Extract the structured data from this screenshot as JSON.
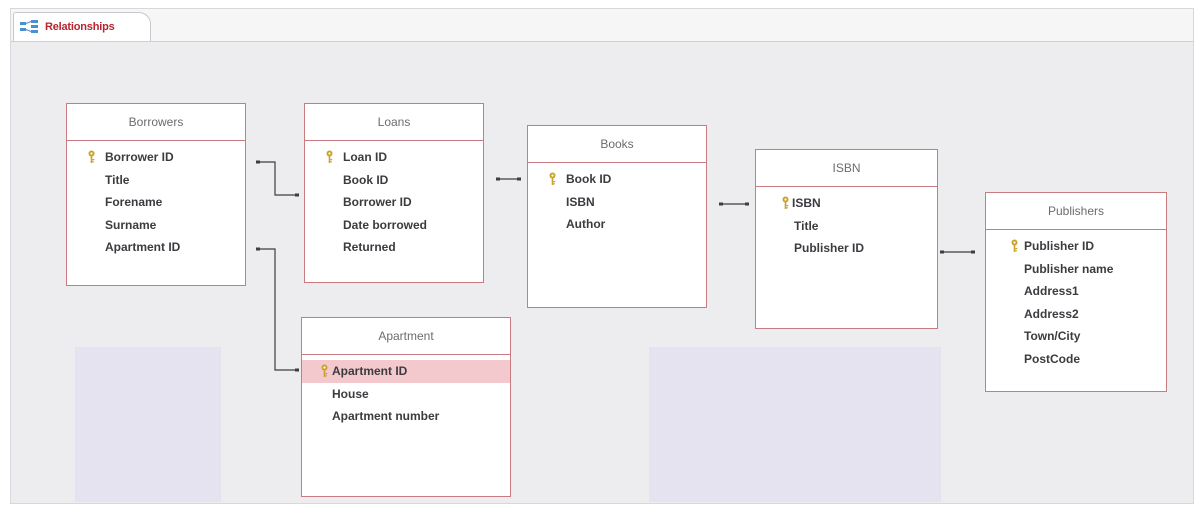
{
  "tab": {
    "icon": "relationships-icon",
    "label": "Relationships"
  },
  "colors": {
    "tab_label": "#b8232d",
    "table_border": "#c97b82",
    "selected_field": "#f3c9cd",
    "key_icon": "#c9a227",
    "canvas": "#ededf0"
  },
  "tables": {
    "borrowers": {
      "title": "Borrowers",
      "fields": [
        "Borrower ID",
        "Title",
        "Forename",
        "Surname",
        "Apartment ID"
      ],
      "primary_key": "Borrower ID"
    },
    "loans": {
      "title": "Loans",
      "fields": [
        "Loan ID",
        "Book ID",
        "Borrower ID",
        "Date borrowed",
        "Returned"
      ],
      "primary_key": "Loan ID"
    },
    "books": {
      "title": "Books",
      "fields": [
        "Book ID",
        "ISBN",
        "Author"
      ],
      "primary_key": "Book ID"
    },
    "isbn": {
      "title": "ISBN",
      "fields": [
        "ISBN",
        "Title",
        "Publisher ID"
      ],
      "primary_key": "ISBN"
    },
    "publishers": {
      "title": "Publishers",
      "fields": [
        "Publisher ID",
        "Publisher name",
        "Address1",
        "Address2",
        "Town/City",
        "PostCode"
      ],
      "primary_key": "Publisher ID"
    },
    "apartment": {
      "title": "Apartment",
      "fields": [
        "Apartment ID",
        "House",
        "Apartment number"
      ],
      "primary_key": "Apartment ID",
      "selected_field": "Apartment ID"
    }
  }
}
